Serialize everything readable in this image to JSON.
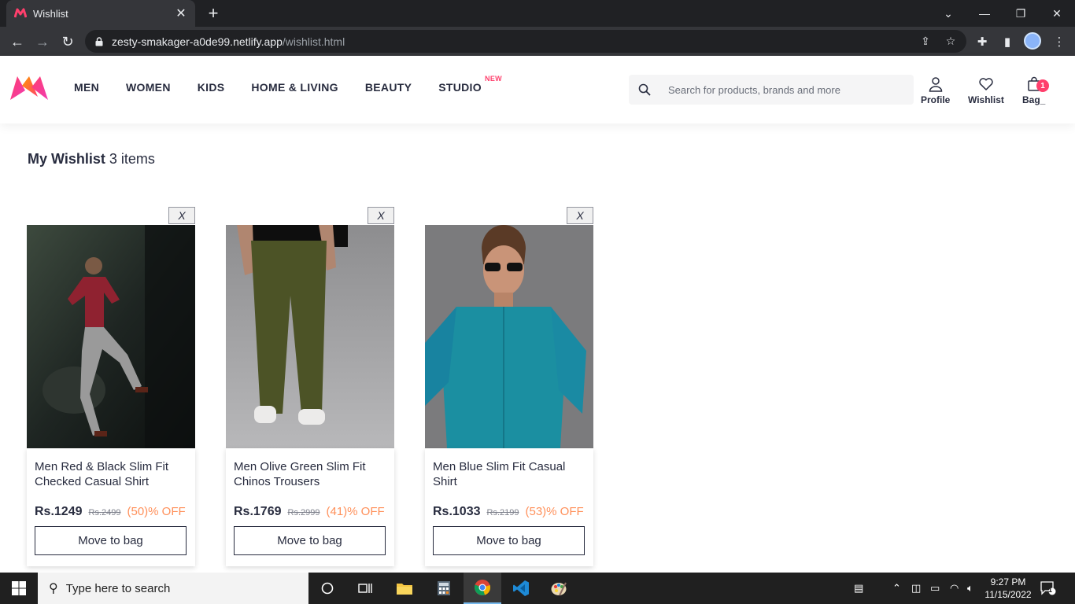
{
  "browser": {
    "tab_title": "Wishlist",
    "url_host": "zesty-smakager-a0de99.netlify.app",
    "url_path": "/wishlist.html"
  },
  "header": {
    "nav": [
      "MEN",
      "WOMEN",
      "KIDS",
      "HOME & LIVING",
      "BEAUTY",
      "STUDIO"
    ],
    "studio_badge": "NEW",
    "search_placeholder": "Search for products, brands and more",
    "profile_label": "Profile",
    "wishlist_label": "Wishlist",
    "bag_label": "Bag_",
    "bag_count": "1",
    "brand_color": "#ff3f6c"
  },
  "page": {
    "title": "My Wishlist",
    "count_text": "3 items"
  },
  "items": [
    {
      "name": "Men Red & Black Slim Fit Checked Casual Shirt",
      "price": "Rs.1249",
      "mrp": "Rs.2499",
      "discount": "(50)% OFF",
      "remove_label": "X",
      "button_label": "Move to bag"
    },
    {
      "name": "Men Olive Green Slim Fit Chinos Trousers",
      "price": "Rs.1769",
      "mrp": "Rs.2999",
      "discount": "(41)% OFF",
      "remove_label": "X",
      "button_label": "Move to bag"
    },
    {
      "name": "Men Blue Slim Fit Casual Shirt",
      "price": "Rs.1033",
      "mrp": "Rs.2199",
      "discount": "(53)% OFF",
      "remove_label": "X",
      "button_label": "Move to bag"
    }
  ],
  "taskbar": {
    "search_placeholder": "Type here to search",
    "time": "9:27 PM",
    "date": "11/15/2022",
    "notification_count": "1"
  }
}
